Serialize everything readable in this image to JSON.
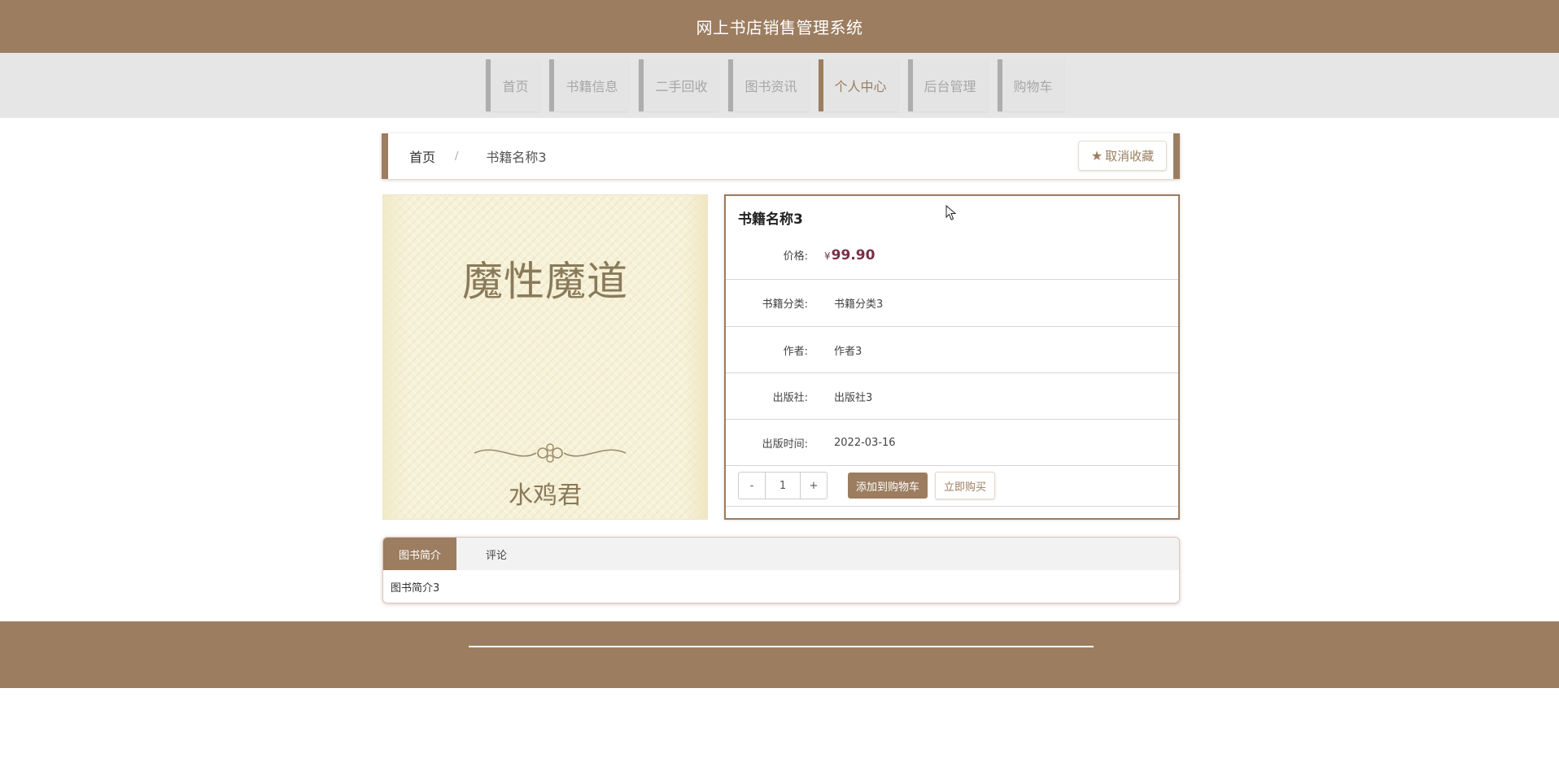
{
  "header": {
    "title": "网上书店销售管理系统"
  },
  "nav": {
    "items": [
      {
        "label": "首页",
        "active": false
      },
      {
        "label": "书籍信息",
        "active": false
      },
      {
        "label": "二手回收",
        "active": false
      },
      {
        "label": "图书资讯",
        "active": false
      },
      {
        "label": "个人中心",
        "active": true
      },
      {
        "label": "后台管理",
        "active": false
      },
      {
        "label": "购物车",
        "active": false
      }
    ]
  },
  "breadcrumb": {
    "home": "首页",
    "separator": "/",
    "current": "书籍名称3"
  },
  "favorite": {
    "icon": "star-icon",
    "label": "取消收藏"
  },
  "cover": {
    "title": "魔性魔道",
    "author": "水鸡君"
  },
  "book": {
    "title": "书籍名称3",
    "price_label": "价格:",
    "currency": "¥",
    "price": "99.90",
    "fields": [
      {
        "label": "书籍分类:",
        "value": "书籍分类3"
      },
      {
        "label": "作者:",
        "value": "作者3"
      },
      {
        "label": "出版社:",
        "value": "出版社3"
      },
      {
        "label": "出版时间:",
        "value": "2022-03-16"
      }
    ]
  },
  "purchase": {
    "minus": "-",
    "quantity": "1",
    "plus": "+",
    "add_to_cart": "添加到购物车",
    "buy_now": "立即购买"
  },
  "tabs": {
    "items": [
      {
        "label": "图书简介",
        "active": true
      },
      {
        "label": "评论",
        "active": false
      }
    ],
    "content": "图书简介3"
  },
  "colors": {
    "brand": "#9c7d60",
    "nav_bg": "#e6e6e6",
    "price": "#7a2e48"
  }
}
